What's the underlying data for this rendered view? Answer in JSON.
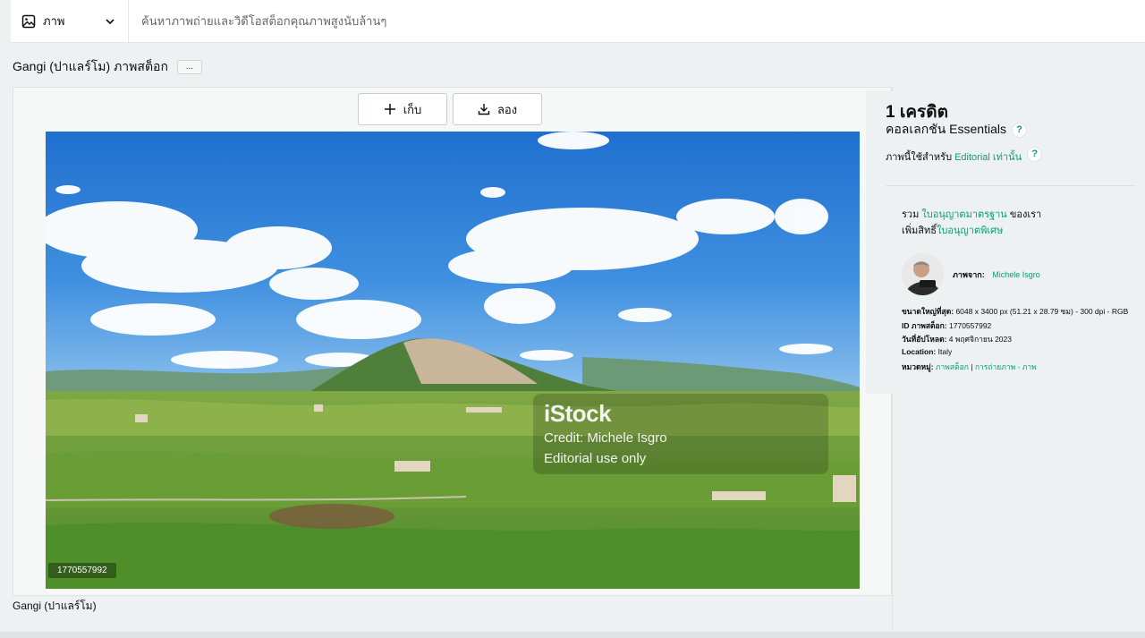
{
  "search": {
    "media_type": "ภาพ",
    "placeholder": "ค้นหาภาพถ่ายและวิดีโอสต็อกคุณภาพสูงนับล้านๆ"
  },
  "page": {
    "title": "Gangi (ปาแลร์โม) ภาพสต็อก",
    "more_label": "...",
    "caption": "Gangi (ปาแลร์โม)"
  },
  "actions": {
    "save_label": "เก็บ",
    "try_label": "ลอง"
  },
  "photo": {
    "watermark_logo": "iStock",
    "watermark_credit": "Credit: Michele Isgro",
    "watermark_editorial": "Editorial use only",
    "id_badge": "1770557992"
  },
  "sidebar": {
    "credits": "1 เครดิต",
    "collection": "คอลเลกชัน Essentials",
    "help_glyph": "?",
    "editorial_prefix": "ภาพนี้ใช้สำหรับ",
    "editorial_link": "Editorial เท่านั้น",
    "license_prefix": "รวม",
    "license_link": "ใบอนุญาตมาตรฐาน",
    "license_suffix": "ของเรา",
    "extended_prefix": "เพิ่มสิทธิ์",
    "extended_link": "ใบอนุญาตพิเศษ",
    "by_label": "ภาพจาก:",
    "photographer": "Michele Isgro",
    "size_label": "ขนาดใหญ่ที่สุด:",
    "size_value": "6048 x 3400 px (51.21 x 28.79 ซม) - 300 dpi - RGB",
    "stock_id_label": "ID ภาพสต็อก:",
    "stock_id_value": "1770557992",
    "upload_label": "วันที่อัปโหลด:",
    "upload_value": "4 พฤศจิกายน 2023",
    "location_label": "Location:",
    "location_value": "Italy",
    "category_label": "หมวดหมู่:",
    "category_1": "ภาพสต็อก",
    "category_sep": "|",
    "category_2": "การถ่ายภาพ - ภาพ"
  },
  "colors": {
    "accent_green": "#08a172",
    "page_bg": "#eef1f1",
    "text": "#0c0d0d"
  }
}
